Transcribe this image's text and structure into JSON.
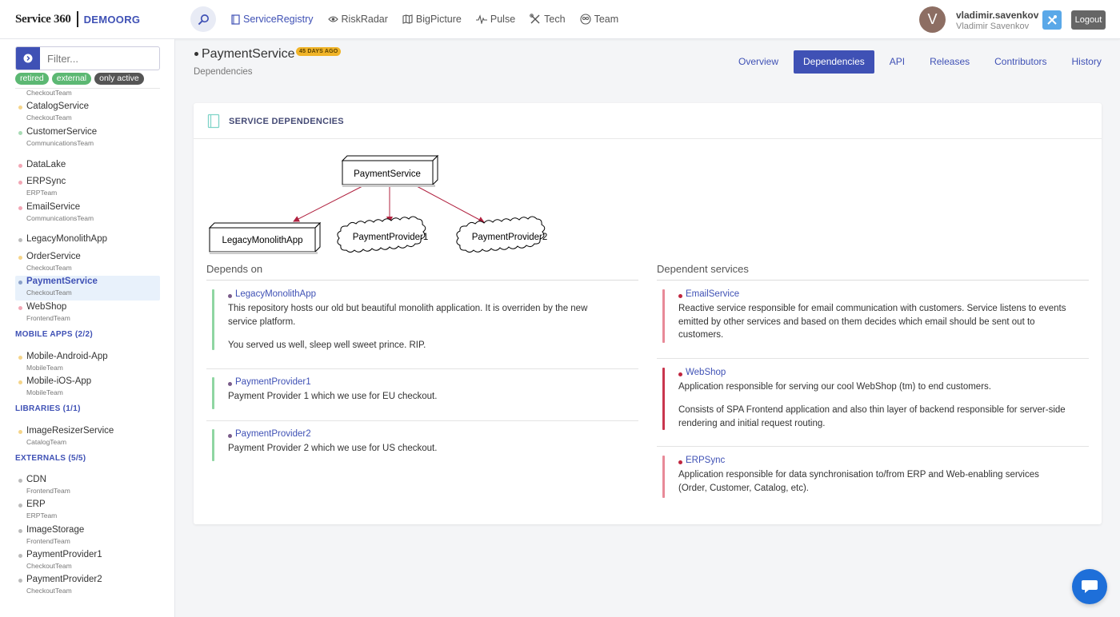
{
  "brand": {
    "name": "Service 360",
    "org": "DEMOORG"
  },
  "nav": [
    {
      "label": "ServiceRegistry",
      "icon": "document-icon",
      "active": true
    },
    {
      "label": "RiskRadar",
      "icon": "eye-icon"
    },
    {
      "label": "BigPicture",
      "icon": "map-icon"
    },
    {
      "label": "Pulse",
      "icon": "pulse-icon"
    },
    {
      "label": "Tech",
      "icon": "tools-icon"
    },
    {
      "label": "Team",
      "icon": "team-icon"
    }
  ],
  "user": {
    "initial": "V",
    "username": "vladimir.savenkov",
    "full_name": "Vladimir Savenkov",
    "logout": "Logout"
  },
  "sidebar": {
    "filter_placeholder": "Filter...",
    "tags": [
      "retired",
      "external",
      "only active"
    ],
    "cut_team": "CheckoutTeam",
    "services": [
      {
        "name": "CatalogService",
        "team": "CheckoutTeam",
        "color": "#f5d58a"
      },
      {
        "name": "CustomerService",
        "team": "CommunicationsTeam",
        "color": "#a8dbb5"
      },
      {
        "name": "DataLake",
        "team": "",
        "color": "#f2a7b5"
      },
      {
        "name": "ERPSync",
        "team": "ERPTeam",
        "color": "#f2a7b5"
      },
      {
        "name": "EmailService",
        "team": "CommunicationsTeam",
        "color": "#f2a7b5"
      },
      {
        "name": "LegacyMonolithApp",
        "team": "",
        "color": "#bbbbbb"
      },
      {
        "name": "OrderService",
        "team": "CheckoutTeam",
        "color": "#f5d58a"
      },
      {
        "name": "PaymentService",
        "team": "CheckoutTeam",
        "color": "#8aa0c8",
        "active": true
      },
      {
        "name": "WebShop",
        "team": "FrontendTeam",
        "color": "#f2a7b5"
      }
    ],
    "mobile_heading": "MOBILE APPS (2/2)",
    "mobile": [
      {
        "name": "Mobile-Android-App",
        "team": "MobileTeam",
        "color": "#f5d58a"
      },
      {
        "name": "Mobile-iOS-App",
        "team": "MobileTeam",
        "color": "#f5d58a"
      }
    ],
    "libraries_heading": "LIBRARIES (1/1)",
    "libraries": [
      {
        "name": "ImageResizerService",
        "team": "CatalogTeam",
        "color": "#f5d58a"
      }
    ],
    "externals_heading": "EXTERNALS (5/5)",
    "externals": [
      {
        "name": "CDN",
        "team": "FrontendTeam",
        "color": "#bbbbbb"
      },
      {
        "name": "ERP",
        "team": "ERPTeam",
        "color": "#bbbbbb"
      },
      {
        "name": "ImageStorage",
        "team": "FrontendTeam",
        "color": "#bbbbbb"
      },
      {
        "name": "PaymentProvider1",
        "team": "CheckoutTeam",
        "color": "#bbbbbb"
      },
      {
        "name": "PaymentProvider2",
        "team": "CheckoutTeam",
        "color": "#bbbbbb"
      }
    ]
  },
  "page": {
    "title": "PaymentService",
    "age_badge": "45 DAYS AGO",
    "subtitle": "Dependencies"
  },
  "tabs": [
    {
      "label": "Overview"
    },
    {
      "label": "Dependencies",
      "active": true
    },
    {
      "label": "API"
    },
    {
      "label": "Releases"
    },
    {
      "label": "Contributors"
    },
    {
      "label": "History"
    }
  ],
  "card": {
    "title": "SERVICE DEPENDENCIES"
  },
  "diagram": {
    "root": "PaymentService",
    "children": [
      "LegacyMonolithApp",
      "PaymentProvider1",
      "PaymentProvider2"
    ]
  },
  "depends_on": {
    "title": "Depends on",
    "items": [
      {
        "name": "LegacyMonolithApp",
        "desc1": "This repository hosts our old but beautiful monolith application. It is overriden by the new service platform.",
        "desc2": "You served us well, sleep well sweet prince. RIP."
      },
      {
        "name": "PaymentProvider1",
        "desc1": "Payment Provider 1 which we use for EU checkout."
      },
      {
        "name": "PaymentProvider2",
        "desc1": "Payment Provider 2 which we use for US checkout."
      }
    ]
  },
  "dependents": {
    "title": "Dependent services",
    "items": [
      {
        "name": "EmailService",
        "desc1": "Reactive service responsible for email communication with customers. Service listens to events emitted by other services and based on them decides which email should be sent out to customers."
      },
      {
        "name": "WebShop",
        "desc1": "Application responsible for serving our cool WebShop (tm) to end customers.",
        "desc2": "Consists of SPA Frontend application and also thin layer of backend responsible for server-side rendering and initial request routing."
      },
      {
        "name": "ERPSync",
        "desc1": "Application responsible for data synchronisation to/from ERP and Web-enabling services (Order, Customer, Catalog, etc)."
      }
    ]
  }
}
